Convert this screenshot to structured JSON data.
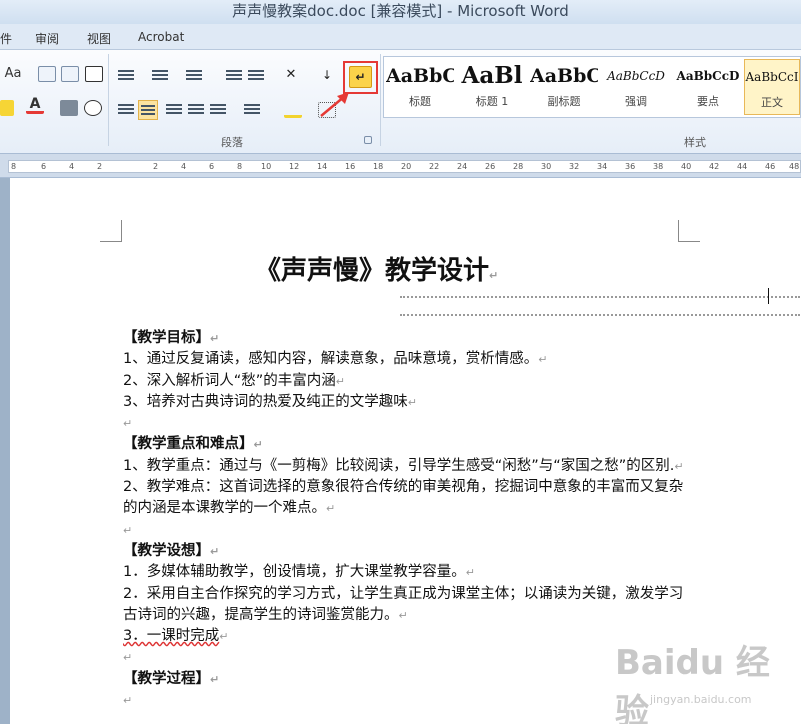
{
  "window": {
    "title": "声声慢教案doc.doc [兼容模式] - Microsoft Word"
  },
  "tabs": [
    {
      "label": "件"
    },
    {
      "label": "审阅"
    },
    {
      "label": "视图"
    },
    {
      "label": "Acrobat"
    }
  ],
  "ribbon": {
    "groups": {
      "paragraph": "段落",
      "styles": "样式"
    },
    "font_size_btn": "Aa",
    "styles_gallery": [
      {
        "preview": "AaBbC",
        "name": "标题"
      },
      {
        "preview": "AaBl",
        "name": "标题 1"
      },
      {
        "preview": "AaBbC",
        "name": "副标题"
      },
      {
        "preview": "AaBbCcD",
        "name": "强调"
      },
      {
        "preview": "AaBbCcD",
        "name": "要点"
      },
      {
        "preview": "AaBbCcI",
        "name": "正文"
      }
    ],
    "colors": {
      "accent": "#e53935",
      "highlight": "#fbd34a"
    }
  },
  "ruler": {
    "ticks": [
      "8",
      "6",
      "4",
      "2",
      "",
      "2",
      "4",
      "6",
      "8",
      "10",
      "12",
      "14",
      "16",
      "18",
      "20",
      "22",
      "24",
      "26",
      "28",
      "30",
      "32",
      "34",
      "36",
      "38",
      "40",
      "42",
      "44",
      "46",
      "48"
    ]
  },
  "document": {
    "title": "《声声慢》教学设计",
    "sections": [
      {
        "heading": "【教学目标】",
        "lines": [
          "1、通过反复诵读，感知内容，解读意象，品味意境，赏析情感。",
          "2、深入解析词人“愁”的丰富内涵",
          "3、培养对古典诗词的热爱及纯正的文学趣味"
        ]
      },
      {
        "heading": "【教学重点和难点】",
        "lines": [
          "1、教学重点：通过与《一剪梅》比较阅读，引导学生感受“闲愁”与“家国之愁”的区别.",
          "2、教学难点：这首词选择的意象很符合传统的审美视角，挖掘词中意象的丰富而又复杂的内涵是本课教学的一个难点。"
        ]
      },
      {
        "heading": "【教学设想】",
        "lines": [
          "1．多媒体辅助教学，创设情境，扩大课堂教学容量。",
          "2．采用自主合作探究的学习方式，让学生真正成为课堂主体；以诵读为关键，激发学习古诗词的兴趣，提高学生的诗词鉴赏能力。",
          "3．一课时完成"
        ]
      },
      {
        "heading": "【教学过程】",
        "lines": []
      }
    ]
  },
  "watermark": {
    "main": "Baidu 经验",
    "sub": "jingyan.baidu.com"
  }
}
